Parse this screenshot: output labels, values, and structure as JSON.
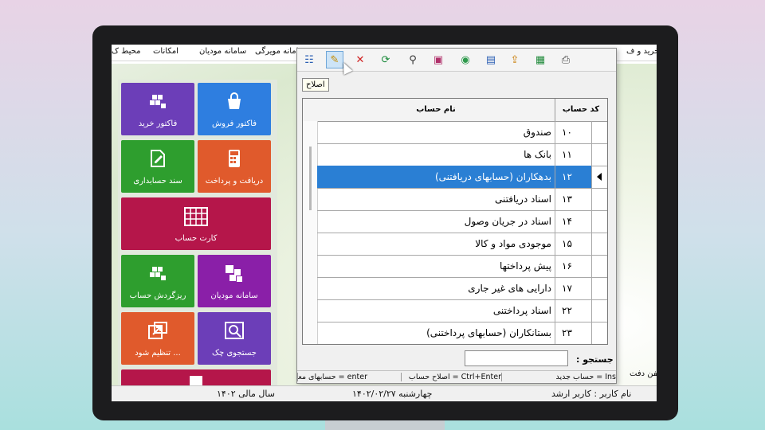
{
  "menu": {
    "items": [
      "خرید و ف",
      "امکانات",
      "سامانه مودیان",
      "سامانه مویرگی",
      "محیط ک"
    ]
  },
  "toolbar": {
    "tooltip": "اصلاح",
    "buttons": [
      {
        "name": "grid-list-icon",
        "glyph": "☷",
        "color": "#2b5fb4"
      },
      {
        "name": "pencil-edit-icon",
        "glyph": "✎",
        "color": "#c58b00"
      },
      {
        "name": "delete-x-icon",
        "glyph": "✕",
        "color": "#d02020"
      },
      {
        "name": "refresh-doc-icon",
        "glyph": "⟳",
        "color": "#1a8a3a"
      },
      {
        "name": "binoculars-icon",
        "glyph": "⚲",
        "color": "#333333"
      },
      {
        "name": "book-icon",
        "glyph": "▣",
        "color": "#b0306a"
      },
      {
        "name": "globe-icon",
        "glyph": "◉",
        "color": "#2e9a4c"
      },
      {
        "name": "chart-icon",
        "glyph": "▤",
        "color": "#2b5fb4"
      },
      {
        "name": "export-icon",
        "glyph": "⇪",
        "color": "#c87a00"
      },
      {
        "name": "excel-icon",
        "glyph": "▦",
        "color": "#1f8a3a"
      },
      {
        "name": "printer-icon",
        "glyph": "⎙",
        "color": "#444444"
      }
    ]
  },
  "grid": {
    "col_code": "کد حساب",
    "col_name": "نام حساب",
    "rows": [
      {
        "code": "۱۰",
        "name": "صندوق"
      },
      {
        "code": "۱۱",
        "name": "بانک ها"
      },
      {
        "code": "۱۲",
        "name": "بدهکاران (حسابهای دریافتنی)"
      },
      {
        "code": "۱۳",
        "name": "اسناد دریافتنی"
      },
      {
        "code": "۱۴",
        "name": "اسناد در جریان وصول"
      },
      {
        "code": "۱۵",
        "name": "موجودی مواد و کالا"
      },
      {
        "code": "۱۶",
        "name": "پیش پرداختها"
      },
      {
        "code": "۱۷",
        "name": "دارایی های غیر جاری"
      },
      {
        "code": "۲۲",
        "name": "اسناد پرداختنی"
      },
      {
        "code": "۲۳",
        "name": "بستانکاران (حسابهای پرداختنی)"
      }
    ],
    "selected_row": 2
  },
  "search": {
    "label": "جستجو :",
    "value": ""
  },
  "hints": {
    "items": [
      "enter = حسابهای معین",
      "Ctrl+Enter = اصلاح حساب",
      "Ins = حساب جدید"
    ]
  },
  "tiles": [
    {
      "label": "فاکتور فروش",
      "color": "#2e7ee0",
      "icon": "shopping-bag-icon"
    },
    {
      "label": "فاکتور خرید",
      "color": "#6c3eb8",
      "icon": "cubes-icon"
    },
    {
      "label": "دریافت و پرداخت",
      "color": "#e05a2c",
      "icon": "calculator-icon"
    },
    {
      "label": "سند حسابداری",
      "color": "#2e9e2e",
      "icon": "document-edit-icon"
    },
    {
      "label": "کارت حساب",
      "color": "#b5164a",
      "icon": "card-grid-icon"
    },
    {
      "label": "سامانه مودیان",
      "color": "#8a1fa8",
      "icon": "squares-icon"
    },
    {
      "label": "ریزگردش حساب",
      "color": "#2e9e2e",
      "icon": "cubes-icon"
    },
    {
      "label": "جستجوی چک",
      "color": "#6c3eb8",
      "icon": "magnifier-icon"
    },
    {
      "label": "تنظیم شود ...",
      "color": "#e05a2c",
      "icon": "export-window-icon"
    },
    {
      "label": "",
      "color": "#b5164a",
      "icon": "card-grid-icon"
    }
  ],
  "status": {
    "user": "نام کاربر : کاربر ارشد",
    "date": "چهارشنبه  ۱۴۰۲/۰۲/۲۷",
    "fiscal_year": "سال مالی ۱۴۰۲"
  },
  "phone_label": "تلفن دفت"
}
